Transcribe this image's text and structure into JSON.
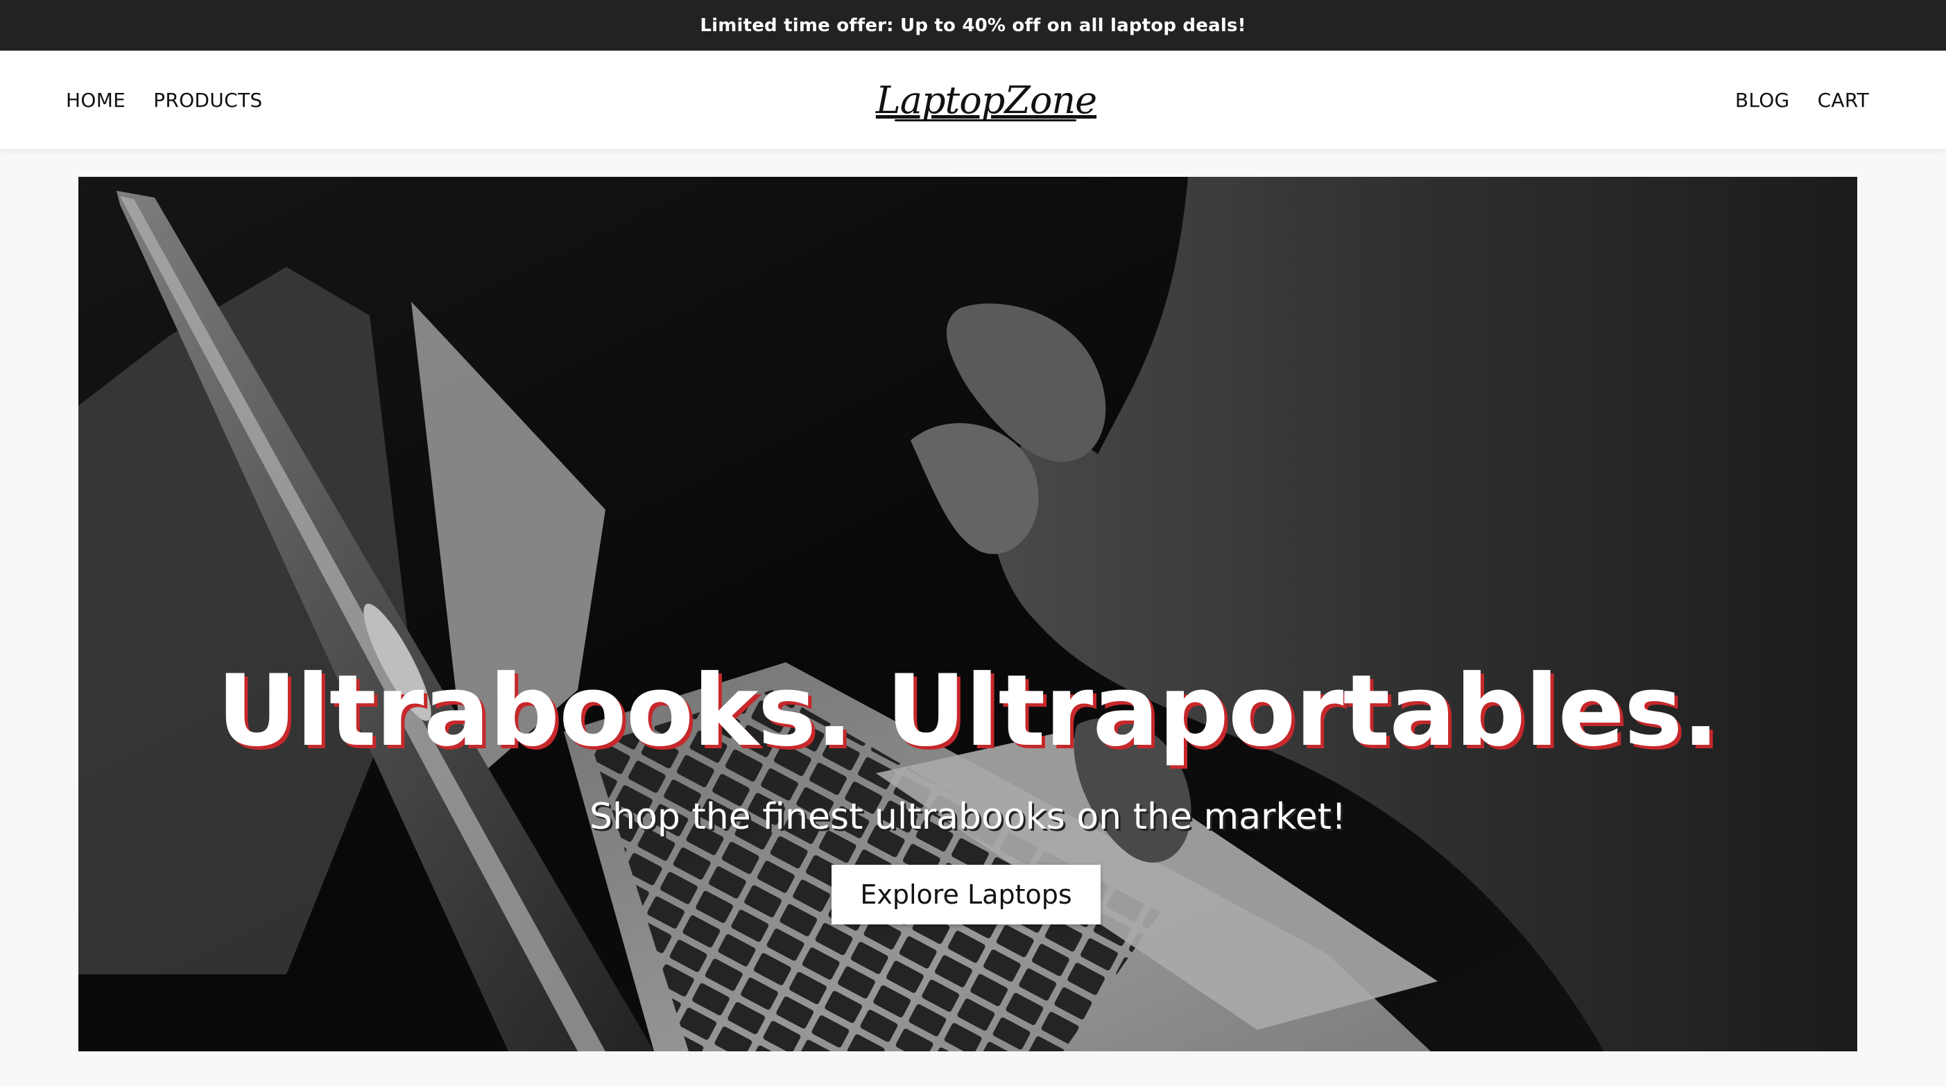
{
  "promo": {
    "text": "Limited time offer: Up to 40% off on all laptop deals!"
  },
  "nav": {
    "left": [
      {
        "label": "HOME"
      },
      {
        "label": "PRODUCTS"
      }
    ],
    "right": [
      {
        "label": "BLOG"
      },
      {
        "label": "CART"
      }
    ],
    "logo": "LaptopZone"
  },
  "hero": {
    "title": "Ultrabooks. Ultraportables.",
    "subtitle": "Shop the finest ultrabooks on the market!",
    "cta_label": "Explore Laptops",
    "image_icon": "laptop-photo-monochrome"
  },
  "colors": {
    "promo_bg": "#222222",
    "header_bg": "#ffffff",
    "page_bg": "#f8f8f8",
    "title_shadow": "#c6282b",
    "button_bg": "#ffffff"
  }
}
